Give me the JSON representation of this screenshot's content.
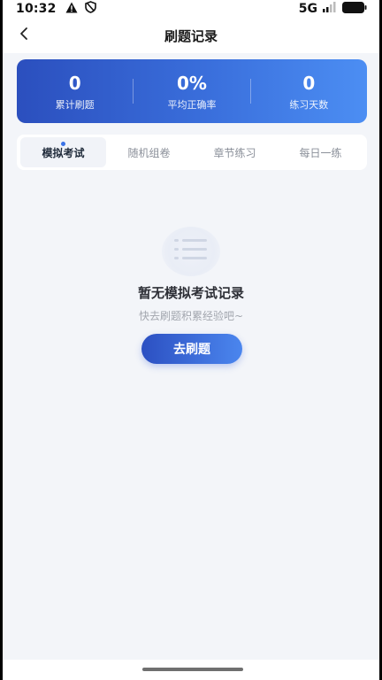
{
  "status_bar": {
    "time": "10:32",
    "left_icons": [
      "warning-icon",
      "shield-icon"
    ],
    "network": "5G",
    "right_icons": [
      "signal-icon",
      "battery-icon"
    ]
  },
  "header": {
    "title": "刷题记录",
    "back_icon": "chevron-left-icon"
  },
  "stats": [
    {
      "value": "0",
      "label": "累计刷题"
    },
    {
      "value": "0%",
      "label": "平均正确率"
    },
    {
      "value": "0",
      "label": "练习天数"
    }
  ],
  "tabs": [
    {
      "label": "模拟考试",
      "active": true
    },
    {
      "label": "随机组卷",
      "active": false
    },
    {
      "label": "章节练习",
      "active": false
    },
    {
      "label": "每日一练",
      "active": false
    }
  ],
  "empty_state": {
    "icon": "list-icon",
    "title": "暂无模拟考试记录",
    "subtitle": "快去刷题积累经验吧~",
    "button_label": "去刷题"
  },
  "colors": {
    "accent": "#3a6fdc",
    "card_gradient_start": "#2b4fbe",
    "card_gradient_end": "#4c8ef3",
    "page_background": "#f3f5f9"
  }
}
